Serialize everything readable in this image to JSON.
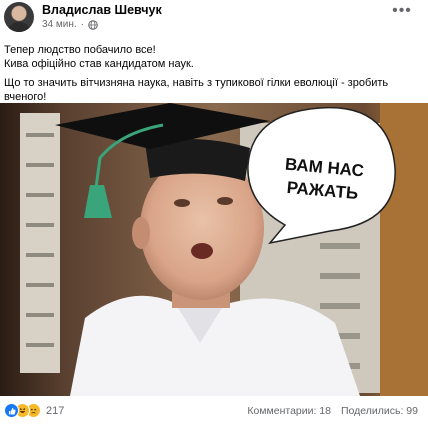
{
  "post": {
    "author": "Владислав Шевчук",
    "time": "34 мин.",
    "more_icon": "ellipsis-icon",
    "privacy_icon": "globe-icon",
    "text": {
      "line1": "Тепер людство побачило все!",
      "line2": "Кива офіційно став кандидатом наук.",
      "line3": "Що то значить вітчизняна наука, навіть з тупикової гілки еволюції - зробить",
      "line4": "вченого!"
    }
  },
  "photo": {
    "speech_bubble": {
      "line1": "ВАМ НАС",
      "line2": "РАЖАТЬ"
    },
    "hat_tassel_color": "#3aa57a"
  },
  "footer": {
    "reaction_icons": [
      "like-icon",
      "haha-icon",
      "sad-icon"
    ],
    "reaction_count": "217",
    "comments": "Комментарии: 18",
    "shares": "Поделились: 99"
  },
  "colors": {
    "link_blue": "#1877f2",
    "secondary_text": "#65676b",
    "emoji_yellow": "#f7b928"
  }
}
